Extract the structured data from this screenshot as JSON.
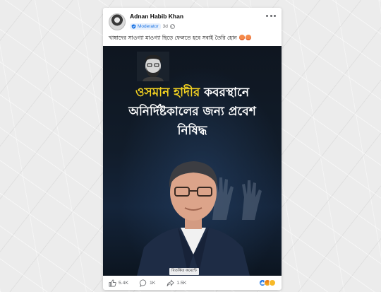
{
  "post": {
    "author_name": "Adnan Habib Khan",
    "badge_label": "Moderator",
    "time": "3d",
    "caption": "খাম্বাদের সাওগ্যা মাওগ্যা ছিড়ে ফেলতে হবে সবাই তৈরি হোন",
    "caption_emojis": [
      "angry-face-emoji",
      "angry-face-emoji"
    ]
  },
  "image": {
    "headline_line1_highlight": "ওসমান হাদীর",
    "headline_line1_rest": "কবরস্থানে",
    "headline_line2": "অনির্দিষ্টকালের জন্য প্রবেশ",
    "headline_line3": "নিষিদ্ধ",
    "highlight_color": "#f5d321",
    "photo_credit": "বিতর্কিত কমেন্টে"
  },
  "actions": {
    "like_count": "5.4K",
    "comment_count": "1K",
    "share_count": "1.5K",
    "reaction_icons": [
      "like-reaction-icon",
      "angry-reaction-icon",
      "haha-reaction-icon"
    ]
  },
  "colors": {
    "accent": "#1b74e4",
    "text_secondary": "#65676b"
  }
}
